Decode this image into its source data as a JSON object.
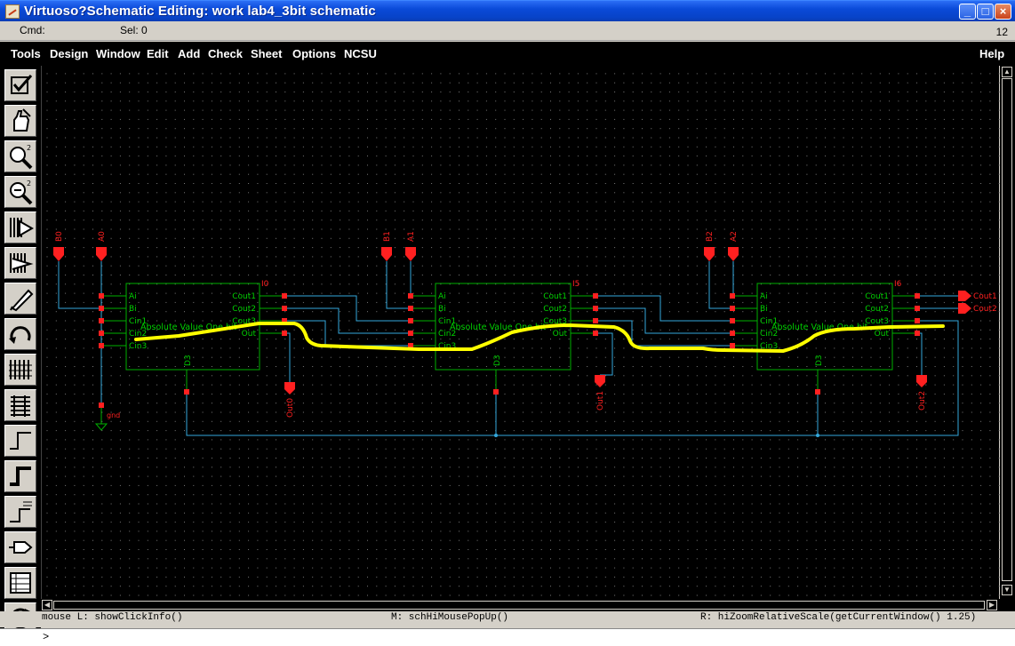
{
  "window": {
    "title": "Virtuoso?Schematic Editing: work lab4_3bit schematic"
  },
  "cmdbar": {
    "cmd_label": "Cmd:",
    "sel_label": "Sel: 0",
    "number": "12"
  },
  "menus": [
    "Tools",
    "Design",
    "Window",
    "Edit",
    "Add",
    "Check",
    "Sheet",
    "Options",
    "NCSU",
    "Help"
  ],
  "toolbar": {
    "icons": [
      "check-save-icon",
      "descend-hand-icon",
      "zoom-in-icon",
      "zoom-out-icon",
      "stretch-icon",
      "copy-icon",
      "wire-pencil-icon",
      "undo-arc-icon",
      "property-icon",
      "bus-icon",
      "wire-narrow-icon",
      "wire-wide-icon",
      "label-icon",
      "pin-icon",
      "delete-icon",
      "redo-icon"
    ]
  },
  "schematic": {
    "blocks": [
      {
        "instance": "I0",
        "name": "Absolute Value One bit",
        "inputs": [
          "Ai",
          "Bi",
          "Cin1",
          "Cin2",
          "Cin3"
        ],
        "outputs": [
          "Cout1",
          "Cout2",
          "Cout3",
          "Out"
        ],
        "bottom_pin": "D3"
      },
      {
        "instance": "I5",
        "name": "Absolute Value One bit",
        "inputs": [
          "Ai",
          "Bi",
          "Cin1",
          "Cin2",
          "Cin3"
        ],
        "outputs": [
          "Cout1",
          "Cout2",
          "Cout3",
          "Out"
        ],
        "bottom_pin": "D3"
      },
      {
        "instance": "I6",
        "name": "Absolute Value One bit",
        "inputs": [
          "Ai",
          "Bi",
          "Cin1",
          "Cin2",
          "Cin3"
        ],
        "outputs": [
          "Cout1",
          "Cout2",
          "Cout3",
          "Out"
        ],
        "bottom_pin": "D3"
      }
    ],
    "input_pins": [
      "B0",
      "A0",
      "B1",
      "A1",
      "B2",
      "A2"
    ],
    "output_pins": [
      "Out0",
      "Out1",
      "Out2"
    ],
    "top_output_pins": [
      "Cout1",
      "Cout2"
    ],
    "ground_label": "gnd",
    "colors": {
      "wire": "#34a8dc",
      "pin": "#ff2020",
      "block": "#00b000",
      "label": "#00d000",
      "highlight": "#ffff00",
      "grid": "#7a7a7a"
    }
  },
  "status": {
    "mouse_l": "mouse L: showClickInfo()",
    "mouse_m": "M: schHiMousePopUp()",
    "mouse_r": "R: hiZoomRelativeScale(getCurrentWindow() 1.25)"
  },
  "cmdline": {
    "prompt": ">",
    "value": ""
  }
}
